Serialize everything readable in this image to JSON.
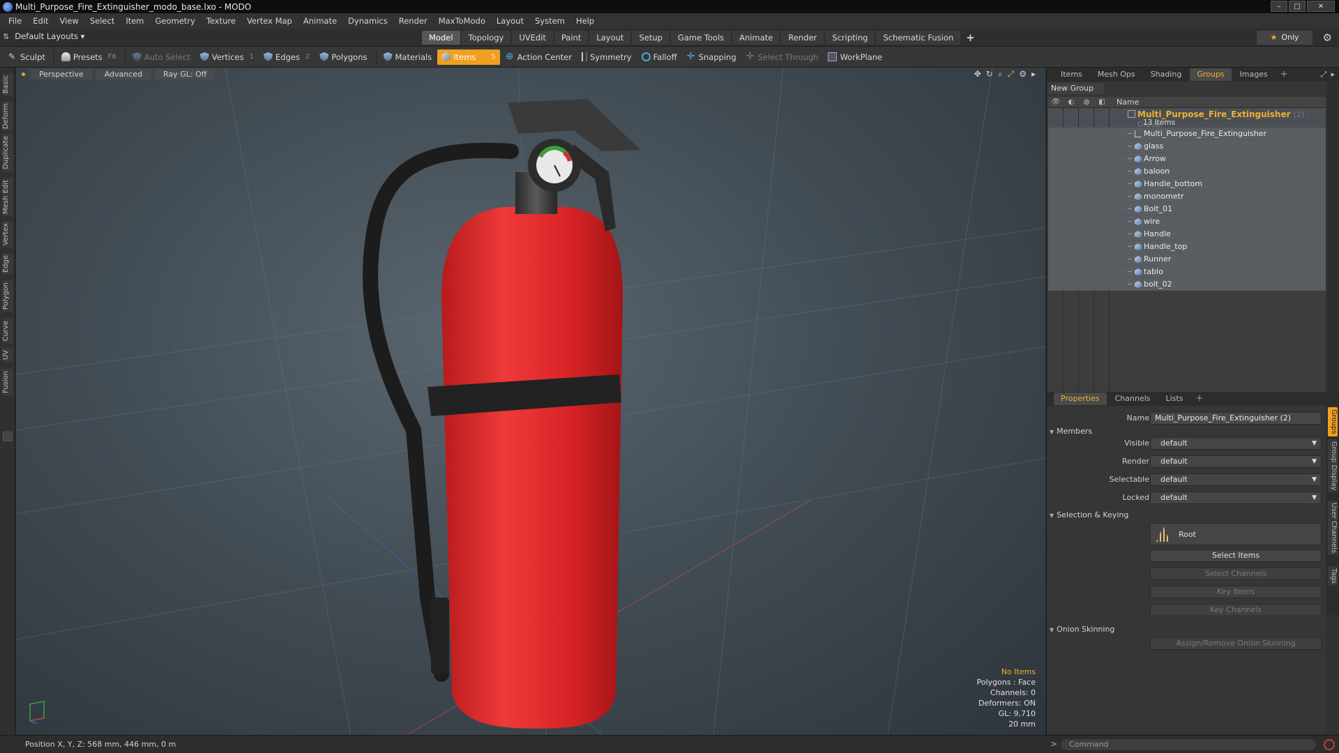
{
  "window": {
    "title": "Multi_Purpose_Fire_Extinguisher_modo_base.lxo - MODO",
    "controls": [
      "–",
      "□",
      "✕"
    ]
  },
  "menu": [
    "File",
    "Edit",
    "View",
    "Select",
    "Item",
    "Geometry",
    "Texture",
    "Vertex Map",
    "Animate",
    "Dynamics",
    "Render",
    "MaxToModo",
    "Layout",
    "System",
    "Help"
  ],
  "layout_bar": {
    "layout_selector": "Default Layouts",
    "tabs": [
      "Model",
      "Topology",
      "UVEdit",
      "Paint",
      "Layout",
      "Setup",
      "Game Tools",
      "Animate",
      "Render",
      "Scripting",
      "Schematic Fusion"
    ],
    "active_tab": "Model",
    "plus": "+",
    "only_label": "Only"
  },
  "toolbar": {
    "sculpt": "Sculpt",
    "presets": "Presets",
    "presets_key": "F6",
    "auto_select": "Auto Select",
    "vertices": "Vertices",
    "vertices_key": "1",
    "edges": "Edges",
    "edges_key": "2",
    "polygons": "Polygons",
    "materials": "Materials",
    "items": "Items",
    "items_key": "5",
    "action_center": "Action Center",
    "symmetry": "Symmetry",
    "falloff": "Falloff",
    "snapping": "Snapping",
    "select_through": "Select Through",
    "workplane": "WorkPlane"
  },
  "left_tabs": [
    "Basic",
    "Deform",
    "Duplicate",
    "Mesh Edit",
    "Vertex",
    "Edge",
    "Polygon",
    "Curve",
    "UV",
    "Fusion"
  ],
  "viewport": {
    "view": "Perspective",
    "shading": "Advanced",
    "raygl": "Ray GL: Off",
    "info": {
      "selection": "No Items",
      "polygons": "Polygons : Face",
      "channels": "Channels: 0",
      "deformers": "Deformers: ON",
      "gl": "GL: 9,710",
      "scale": "20 mm"
    }
  },
  "right_panel": {
    "tabs": [
      "Items",
      "Mesh Ops",
      "Shading",
      "Groups",
      "Images"
    ],
    "active_tab": "Groups",
    "new_group": "New Group",
    "name_header": "Name",
    "group": {
      "name": "Multi_Purpose_Fire_Extinguisher",
      "suffix": "(2) : Group",
      "count": "13 Items",
      "children": [
        "Multi_Purpose_Fire_Extinguisher",
        "glass",
        "Arrow",
        "baloon",
        "Handle_bottom",
        "monometr",
        "Bolt_01",
        "wire",
        "Handle",
        "Handle_top",
        "Runner",
        "tablo",
        "bolt_02"
      ]
    },
    "props_tabs": [
      "Properties",
      "Channels",
      "Lists"
    ],
    "props_active": "Properties",
    "properties": {
      "name_label": "Name",
      "name_value": "Multi_Purpose_Fire_Extinguisher (2)",
      "members_section": "Members",
      "visible_label": "Visible",
      "visible_value": "default",
      "render_label": "Render",
      "render_value": "default",
      "selectable_label": "Selectable",
      "selectable_value": "default",
      "locked_label": "Locked",
      "locked_value": "default",
      "selection_section": "Selection & Keying",
      "root_label": "Root",
      "select_items": "Select Items",
      "select_channels": "Select Channels",
      "key_items": "Key Items",
      "key_channels": "Key Channels",
      "onion_section": "Onion Skinning",
      "assign_onion": "Assign/Remove Onion Skinning"
    },
    "side_tabs": [
      "Groups",
      "Group Display",
      "User Channels",
      "Tags"
    ]
  },
  "status": {
    "position": "Position X, Y, Z:   568 mm, 446 mm, 0 m",
    "command_prompt": ">",
    "command_placeholder": "Command"
  },
  "colors": {
    "accent": "#f0a020",
    "group_name": "#f0b030",
    "extinguisher_red": "#e0282a"
  }
}
